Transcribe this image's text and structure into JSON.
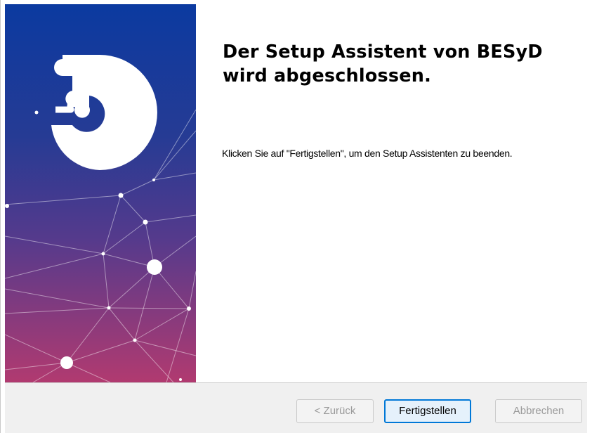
{
  "wizard": {
    "heading": "Der Setup Assistent von BESyD wird abgeschlossen.",
    "message": "Klicken Sie auf \"Fertigstellen\", um den Setup Assistenten zu beenden."
  },
  "side_panel": {
    "logo_icon": "puzzle-piece-logo-icon",
    "gradient": [
      "#0d3a99",
      "#2d3a8c",
      "#6a3a8a",
      "#b23a6e"
    ]
  },
  "buttons": {
    "back_label": "< Zurück",
    "finish_label": "Fertigstellen",
    "cancel_label": "Abbrechen"
  }
}
